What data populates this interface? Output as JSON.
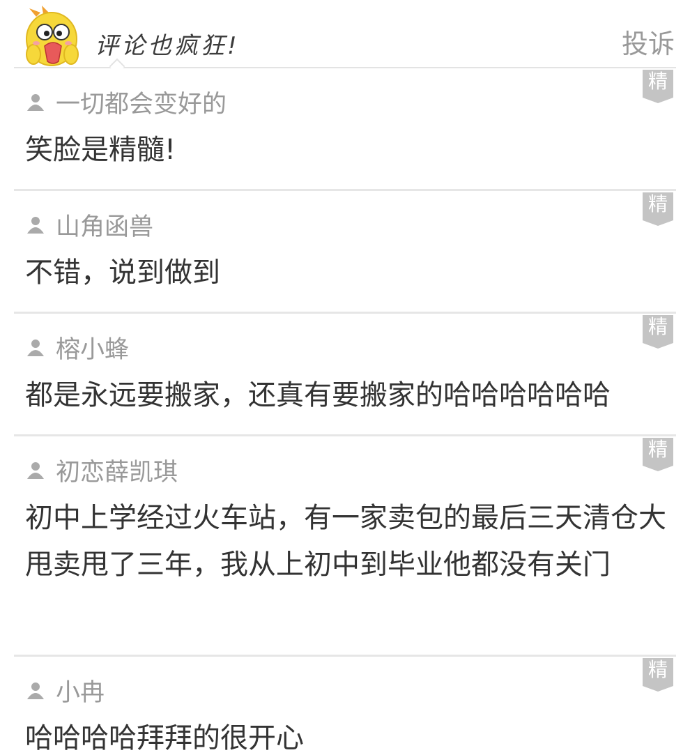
{
  "header": {
    "title": "评论也疯狂!",
    "complain_label": "投诉"
  },
  "badge_label": "精",
  "comments": [
    {
      "author": "一切都会变好的",
      "text": "笑脸是精髓!"
    },
    {
      "author": "山角函兽",
      "text": "不错，说到做到"
    },
    {
      "author": "榕小蜂",
      "text": "都是永远要搬家，还真有要搬家的哈哈哈哈哈哈"
    },
    {
      "author": "初恋薛凯琪",
      "text": "初中上学经过火车站，有一家卖包的最后三天清仓大甩卖甩了三年，我从上初中到毕业他都没有关门"
    },
    {
      "author": "小冉",
      "text": "哈哈哈哈拜拜的很开心"
    }
  ],
  "colors": {
    "author": "#999999",
    "text": "#333333",
    "divider": "#e6e6e6",
    "badge": "#c4c4c4",
    "mascot": "#f6d83a"
  },
  "icons": {
    "mascot": "yellow-bird-mascot",
    "user": "user-icon",
    "badge": "featured-badge"
  }
}
